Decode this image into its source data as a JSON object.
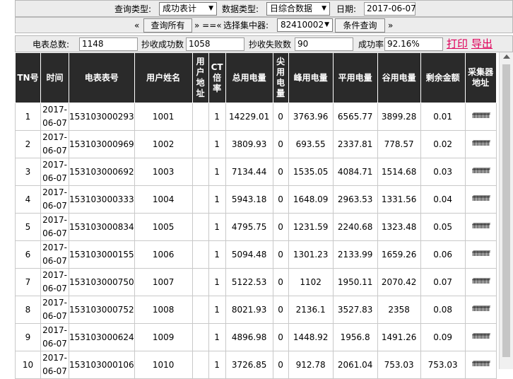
{
  "query_bar": {
    "query_type_label": "查询类型:",
    "query_type_value": "成功表计",
    "data_type_label": "数据类型:",
    "data_type_value": "日综合数据",
    "date_label": "日期:",
    "date_value": "2017-06-07"
  },
  "nav_bar": {
    "prev_symbol": "«",
    "query_all_label": "查询所有",
    "separator": "» ==«",
    "concentrator_label": "选择集中器:",
    "concentrator_value": "82410002",
    "condition_query_label": "条件查询",
    "next_symbol": "»"
  },
  "stats": {
    "meter_total_label": "电表总数:",
    "meter_total_value": "1148",
    "success_label": "抄收成功数",
    "success_value": "1058",
    "fail_label": "抄收失败数",
    "fail_value": "90",
    "rate_label": "成功率",
    "rate_value": "92.16%",
    "print_label": "打印",
    "export_label": "导出"
  },
  "table": {
    "headers": [
      "TN号",
      "时间",
      "电表表号",
      "用户姓名",
      "用户地址",
      "CT倍率",
      "总用电量",
      "尖用电量",
      "峰用电量",
      "平用电量",
      "谷用电量",
      "剩余金额",
      "采集器地址"
    ],
    "rows": [
      [
        "1",
        "2017-06-07",
        "153103000293",
        "1001",
        "",
        "1",
        "14229.01",
        "0",
        "3763.96",
        "6565.77",
        "3899.28",
        "0.01",
        "ffffffffffff"
      ],
      [
        "2",
        "2017-06-07",
        "153103000969",
        "1002",
        "",
        "1",
        "3809.93",
        "0",
        "693.55",
        "2337.81",
        "778.57",
        "0.02",
        "ffffffffffff"
      ],
      [
        "3",
        "2017-06-07",
        "153103000692",
        "1003",
        "",
        "1",
        "7134.44",
        "0",
        "1535.05",
        "4084.71",
        "1514.68",
        "0.03",
        "ffffffffffff"
      ],
      [
        "4",
        "2017-06-07",
        "153103000333",
        "1004",
        "",
        "1",
        "5943.18",
        "0",
        "1648.09",
        "2963.53",
        "1331.56",
        "0.04",
        "ffffffffffff"
      ],
      [
        "5",
        "2017-06-07",
        "153103000834",
        "1005",
        "",
        "1",
        "4795.75",
        "0",
        "1231.59",
        "2240.68",
        "1323.48",
        "0.05",
        "ffffffffffff"
      ],
      [
        "6",
        "2017-06-07",
        "153103000155",
        "1006",
        "",
        "1",
        "5094.48",
        "0",
        "1301.23",
        "2133.99",
        "1659.26",
        "0.06",
        "ffffffffffff"
      ],
      [
        "7",
        "2017-06-07",
        "153103000750",
        "1007",
        "",
        "1",
        "5122.53",
        "0",
        "1102",
        "1950.11",
        "2070.42",
        "0.07",
        "ffffffffffff"
      ],
      [
        "8",
        "2017-06-07",
        "153103000752",
        "1008",
        "",
        "1",
        "8021.93",
        "0",
        "2136.1",
        "3527.83",
        "2358",
        "0.08",
        "ffffffffffff"
      ],
      [
        "9",
        "2017-06-07",
        "153103000624",
        "1009",
        "",
        "1",
        "4896.98",
        "0",
        "1448.92",
        "1956.8",
        "1491.26",
        "0.09",
        "ffffffffffff"
      ],
      [
        "10",
        "2017-06-07",
        "153103000106",
        "1010",
        "",
        "1",
        "3726.85",
        "0",
        "912.78",
        "2061.04",
        "753.03",
        "753.03",
        "ffffffffffff"
      ]
    ]
  }
}
